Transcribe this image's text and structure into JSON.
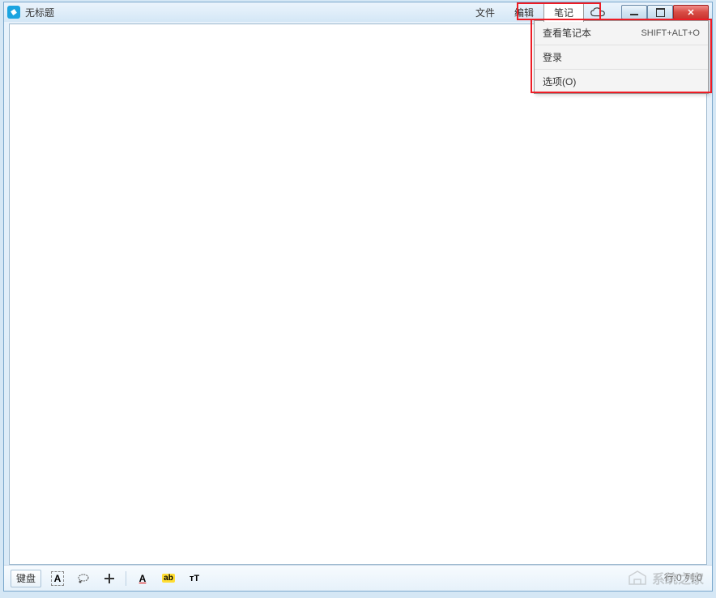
{
  "titlebar": {
    "title": "无标题"
  },
  "menu": {
    "file": "文件",
    "edit": "编辑",
    "note": "笔记"
  },
  "dropdown": {
    "items": [
      {
        "label": "查看笔记本",
        "shortcut": "SHIFT+ALT+O"
      },
      {
        "label": "登录",
        "shortcut": ""
      },
      {
        "label": "选项(O)",
        "shortcut": ""
      }
    ]
  },
  "toolbar": {
    "keyboard": "键盘",
    "selection_a": "A",
    "font_color_a": "A",
    "highlight_ab": "ab",
    "text_size": "тT"
  },
  "status": {
    "text": "行:0 列:0"
  },
  "watermark": {
    "text": "系统之家"
  },
  "icons": {
    "app": "app-icon",
    "cloud": "cloud-icon",
    "minimize": "minimize-icon",
    "maximize": "maximize-icon",
    "close": "close-icon",
    "lasso": "lasso-icon",
    "plus": "plus-icon"
  },
  "colors": {
    "highlight_red": "#ee1c25",
    "close_btn": "#d84c45",
    "app_icon": "#1ba4e0"
  }
}
